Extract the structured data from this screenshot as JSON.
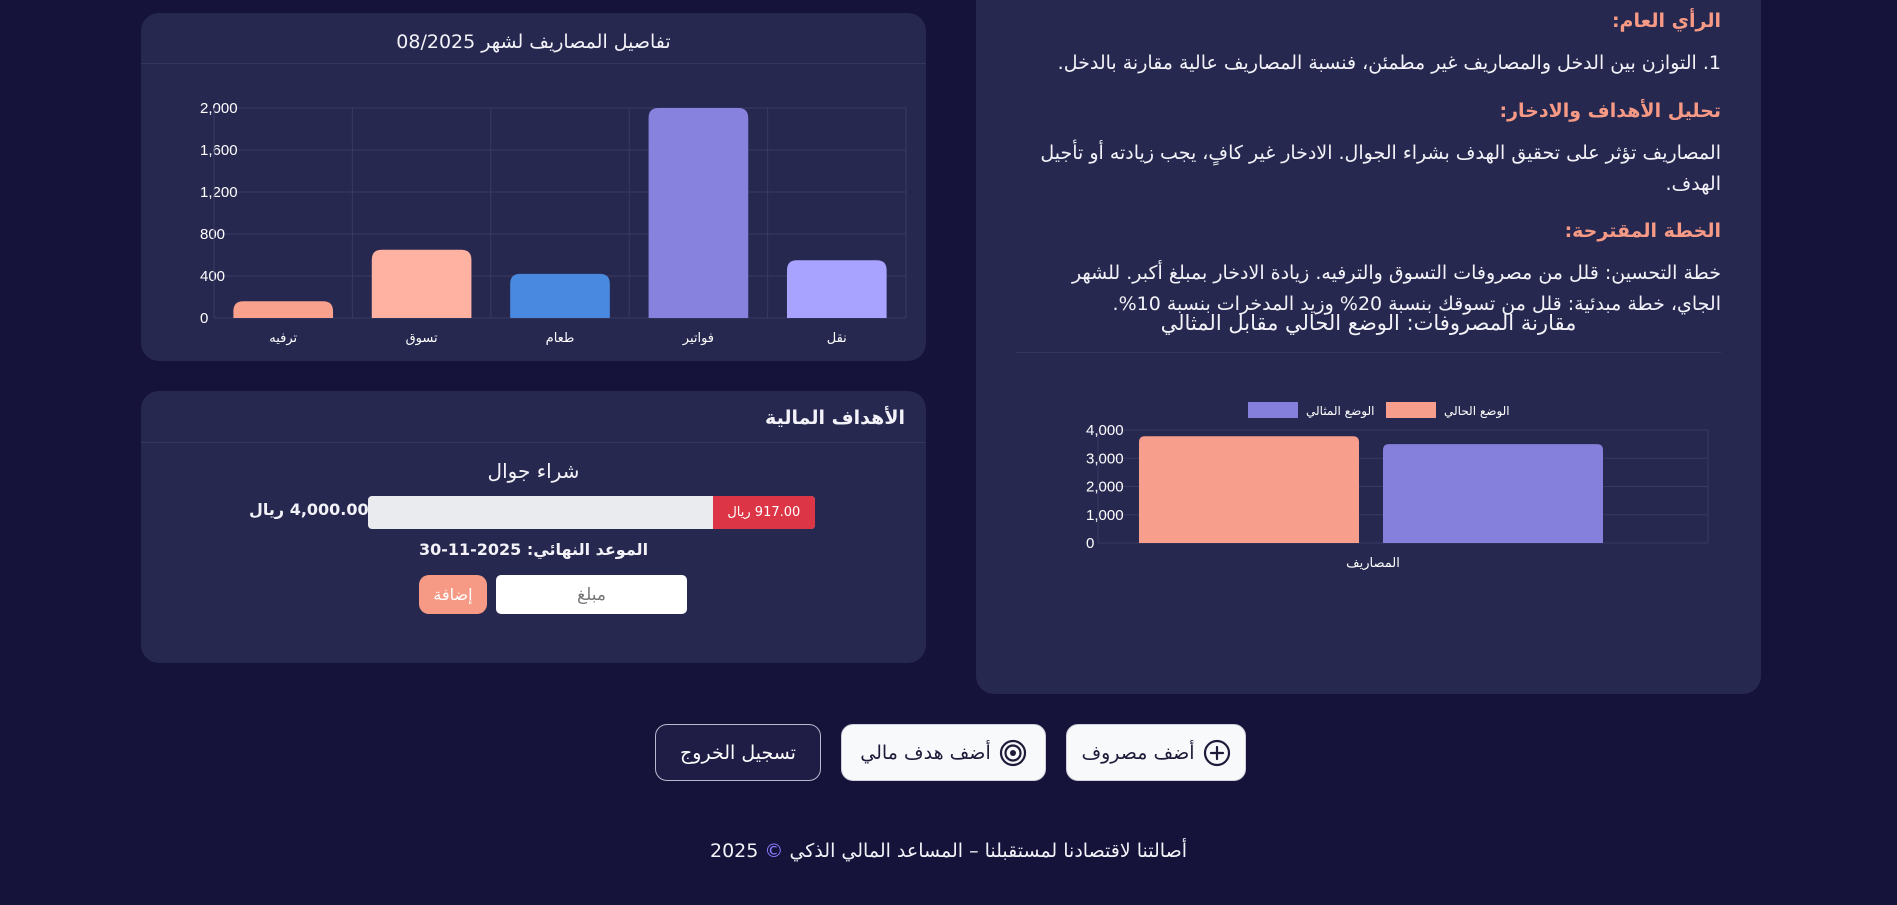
{
  "analysis": {
    "overview_heading": "الرأي العام:",
    "overview_text": "1. التوازن بين الدخل والمصاريف غير مطمئن، فنسبة المصاريف عالية مقارنة بالدخل.",
    "goals_heading": "تحليل الأهداف والادخار:",
    "goals_text": "المصاريف تؤثر على تحقيق الهدف بشراء الجوال. الادخار غير كافٍ، يجب زيادته أو تأجيل الهدف.",
    "plan_heading": "الخطة المقترحة:",
    "plan_text": "خطة التحسين: قلل من مصروفات التسوق والترفيه. زيادة الادخار بمبلغ أكبر. للشهر الجاي، خطة مبدئية: قلل من تسوقك بنسبة 20% وزيد المدخرات بنسبة 10%.",
    "compare_title": "مقارنة المصروفات: الوضع الحالي مقابل المثالي"
  },
  "expense_card": {
    "title": "تفاصيل المصاريف لشهر 08/2025"
  },
  "goals_card": {
    "title": "الأهداف المالية",
    "goal_name": "شراء جوال",
    "saved_label": "917.00 ريال",
    "saved_fraction": 0.229,
    "target_label": "4,000.00 ريال",
    "deadline": "الموعد النهائي: 2025-11-30",
    "amount_placeholder": "مبلغ",
    "add_label": "إضافة"
  },
  "actions": {
    "add_expense": "أضف مصروف",
    "add_goal": "أضف هدف مالي",
    "logout": "تسجيل الخروج"
  },
  "footer": {
    "text": "أصالتنا لاقتصادنا لمستقبلنا – المساعد المالي الذكي",
    "copy": "©",
    "year": "2025"
  },
  "chart_data": [
    {
      "type": "bar",
      "categories": [
        "نقل",
        "فواتير",
        "طعام",
        "تسوق",
        "ترفيه"
      ],
      "values": [
        550,
        2000,
        420,
        650,
        160
      ],
      "colors": [
        "#a7a3ff",
        "#8682dd",
        "#4a89e0",
        "#ffb1a2",
        "#f9a18d"
      ],
      "ylim": [
        0,
        2000
      ],
      "yticks": [
        0,
        400,
        800,
        1200,
        1600,
        2000
      ],
      "ytick_labels": [
        "0",
        "400",
        "800",
        "1,200",
        "1,600",
        "2,000"
      ],
      "grid": true,
      "legend": "none"
    },
    {
      "type": "bar",
      "categories": [
        "المصاريف"
      ],
      "series": [
        {
          "name": "الوضع الحالي",
          "values": [
            3780
          ],
          "color": "#f79f8c"
        },
        {
          "name": "الوضع المثالي",
          "values": [
            3500
          ],
          "color": "#8580dc"
        }
      ],
      "ylim": [
        0,
        4000
      ],
      "yticks": [
        0,
        1000,
        2000,
        3000,
        4000
      ],
      "ytick_labels": [
        "0",
        "1,000",
        "2,000",
        "3,000",
        "4,000"
      ],
      "grid": true,
      "legend": "top"
    }
  ]
}
